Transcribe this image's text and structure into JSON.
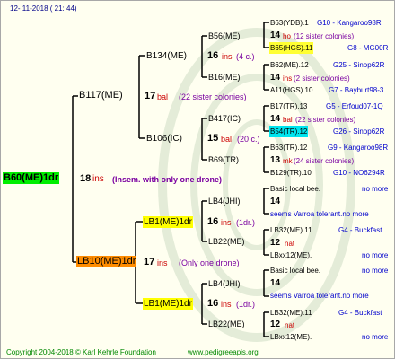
{
  "header": {
    "date": "12- 11-2018 ( 21: 44)"
  },
  "footer": {
    "copyright": "Copyright 2004-2018 © Karl Kehrle Foundation",
    "site": "www.pedigreeapis.org"
  },
  "colors": {
    "root_box": "#00ee00",
    "lb10_box": "#ff8c00",
    "lb1_box": "#ffff00",
    "b65_box": "#ffff33",
    "b54_box": "#00e5ee",
    "line": "#000000",
    "border": "#a8a8a8"
  },
  "root": {
    "label": "B60(ME)1dr",
    "number": "18",
    "ins": "ins",
    "note": "(Insem. with only one drone)"
  },
  "gen1": {
    "b117": {
      "label": "B117(ME)",
      "number": "17",
      "tag": "bal",
      "note": "(22 sister colonies)"
    },
    "lb10": {
      "label": "LB10(ME)1dr",
      "number": "17",
      "ins": "ins",
      "note": "(Only one drone)"
    }
  },
  "gen2": {
    "b134": {
      "label": "B134(ME)",
      "number": "16",
      "ins": "ins",
      "note": "(4 c.)"
    },
    "b106": {
      "label": "B106(IC)",
      "number": "15",
      "tag": "bal",
      "note": "(20 c.)"
    },
    "lb1a": {
      "label": "LB1(ME)1dr",
      "number": "16",
      "ins": "ins",
      "note": "(1dr.)"
    },
    "lb1b": {
      "label": "LB1(ME)1dr",
      "number": "16",
      "ins": "ins",
      "note": "(1dr.)"
    }
  },
  "gen3": {
    "b56": {
      "label": "B56(ME)"
    },
    "b16": {
      "label": "B16(ME)"
    },
    "b417": {
      "label": "B417(IC)"
    },
    "b69": {
      "label": "B69(TR)"
    },
    "lb4a": {
      "label": "LB4(JHI)"
    },
    "lb22a": {
      "label": "LB22(ME)"
    },
    "lb4b": {
      "label": "LB4(JHI)"
    },
    "lb22b": {
      "label": "LB22(ME)"
    }
  },
  "gen4": {
    "r1": {
      "left": "B63(YDB).1",
      "right": "G10 - Kangaroo98R"
    },
    "r2": {
      "number": "14",
      "tag": "ho",
      "note": "(12 sister colonies)"
    },
    "r3": {
      "left": "B65(HGS).11",
      "right": "G8 - MG00R"
    },
    "r4": {
      "left": "B62(ME).12",
      "right": "G25 - Sinop62R"
    },
    "r5": {
      "number": "14",
      "ins": "ins",
      "note": "(2 sister colonies)"
    },
    "r6": {
      "left": "A11(HGS).10",
      "right": "G7 - Bayburt98-3"
    },
    "r7": {
      "left": "B17(TR).13",
      "right": "G5 - Erfoud07-1Q"
    },
    "r8": {
      "number": "14",
      "tag": "bal",
      "note": "(22 sister colonies)"
    },
    "r9": {
      "left": "B54(TR).12",
      "right": "G26 - Sinop62R"
    },
    "r10": {
      "left": "B63(TR).12",
      "right": "G9 - Kangaroo98R"
    },
    "r11": {
      "number": "13",
      "tag": "mk",
      "note": "(24 sister colonies)"
    },
    "r12": {
      "left": "B129(TR).10",
      "right": "G10 - NO6294R"
    },
    "r13": {
      "left": "Basic local bee.",
      "right": "no more"
    },
    "r14": {
      "number": "14"
    },
    "r15": {
      "text": "seems Varroa tolerant.no more"
    },
    "r16": {
      "left": "LB32(ME).11",
      "right": "G4 - Buckfast"
    },
    "r17": {
      "number": "12",
      "tag": "nat"
    },
    "r18": {
      "left": "LBxx12(ME).",
      "right": "no more"
    },
    "r19": {
      "left": "Basic local bee.",
      "right": "no more"
    },
    "r20": {
      "number": "14"
    },
    "r21": {
      "text": "seems Varroa tolerant.no more"
    },
    "r22": {
      "left": "LB32(ME).11",
      "right": "G4 - Buckfast"
    },
    "r23": {
      "number": "12",
      "tag": "nat"
    },
    "r24": {
      "left": "LBxx12(ME).",
      "right": "no more"
    }
  }
}
